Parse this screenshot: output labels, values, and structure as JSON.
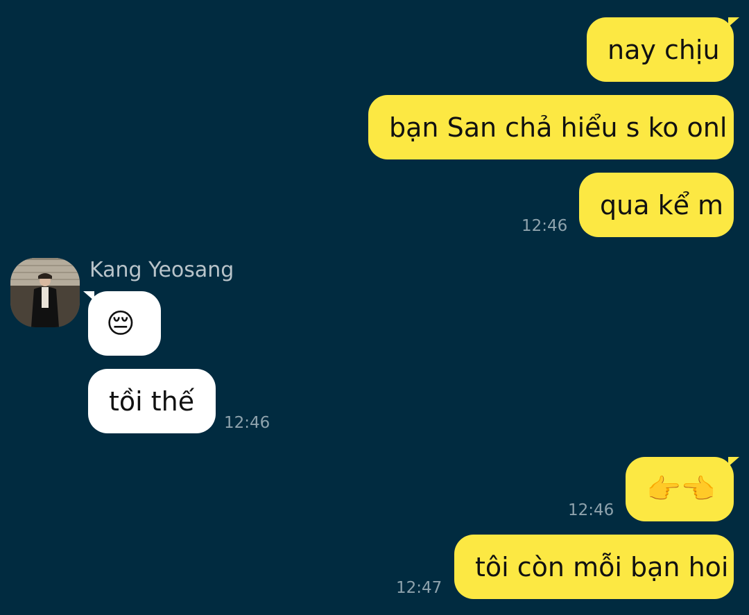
{
  "messages": {
    "m1": {
      "text": "nay chịu"
    },
    "m2": {
      "text": "bạn San chả hiểu s ko onl"
    },
    "m3": {
      "text": "qua kể m",
      "time": "12:46"
    },
    "m4": {
      "sender": "Kang Yeosang",
      "emoji": "😔"
    },
    "m5": {
      "text": "tồi thế",
      "time": "12:46"
    },
    "m6": {
      "emoji": "👉👈",
      "time": "12:46"
    },
    "m7": {
      "text": "tôi còn mỗi bạn hoi",
      "time": "12:47"
    }
  },
  "colors": {
    "background": "#012B40",
    "outgoing_bubble": "#FCE843",
    "incoming_bubble": "#FFFFFF",
    "timestamp": "#8FA3AD",
    "sender_name": "#B9C4CA"
  },
  "icons": {
    "avatar": "profile-photo"
  }
}
